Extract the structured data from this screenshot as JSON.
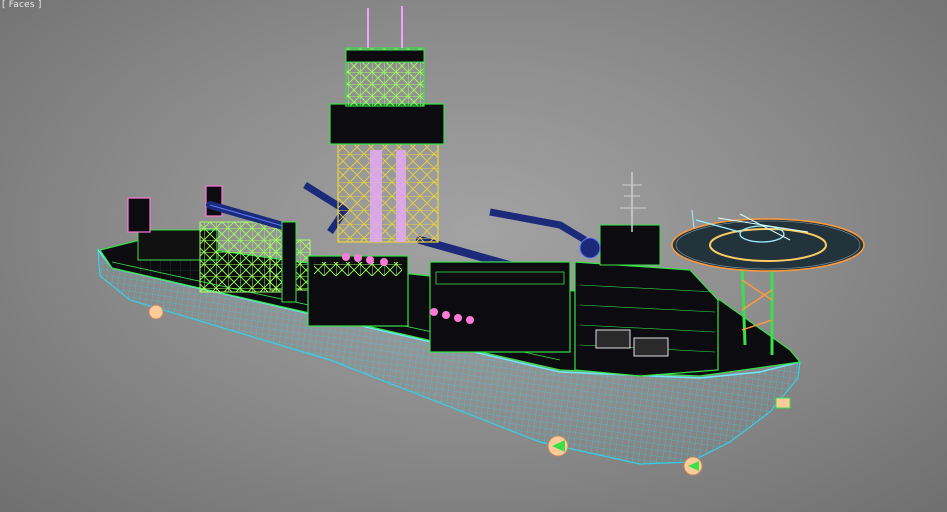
{
  "viewport": {
    "label": "[ Faces ]"
  },
  "scene": {
    "model": "drillship-wireframe",
    "colors": {
      "hull_wire": "#35d0e8",
      "deck_wire": "#39e04a",
      "derrick_wire": "#e9d23a",
      "crane_arm": "#1c2a7a",
      "pipe_rack": "#a8ff6a",
      "accent_pink": "#ff7ad9",
      "accent_purple": "#9a50ff",
      "helideck": "#22333b",
      "helideck_ring": "#ff9a3c",
      "thruster": "#ffcc99",
      "dark_fill": "#0b0b10"
    },
    "icons": [
      "helicopter",
      "drilling-derrick",
      "crane",
      "thruster",
      "antenna-mast",
      "lifeboat"
    ]
  }
}
